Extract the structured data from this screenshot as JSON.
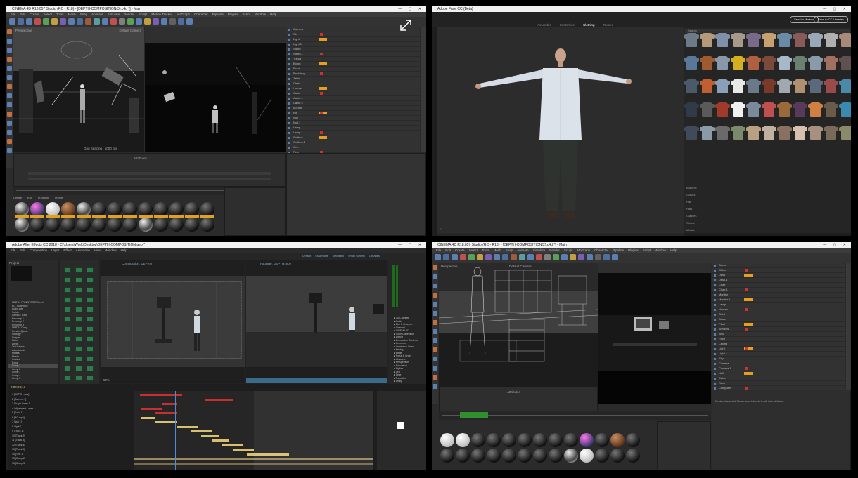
{
  "screens": [
    {
      "title": "CINEMA 4D R18.057 Studio (RC - R18) - [DEPTH-COMPOSITION(3).c4d *] - Main",
      "menu": [
        "File",
        "Edit",
        "Create",
        "Select",
        "Tools",
        "Mesh",
        "Snap",
        "Animate",
        "Simulate",
        "Render",
        "Sculpt",
        "Motion Tracker",
        "MoGraph",
        "Character",
        "Pipeline",
        "Plugins",
        "Script",
        "Window",
        "Help"
      ],
      "layout_label": "Startup (User)",
      "viewport_label": "Perspective",
      "viewport_camera": "Default Camera",
      "grid_spacing": "Grid Spacing : 1000 cm",
      "frame_label": "Frame: 93",
      "objects": [
        "Camera",
        "Sky",
        "Light",
        "Light.1",
        "Stand",
        "Stand.1",
        "Tripod",
        "Boom",
        "Floor",
        "Backdrop",
        "Table",
        "Chair",
        "Human",
        "Cable",
        "Cable.1",
        "Cable.2",
        "Monitor",
        "Rig",
        "Null",
        "Null.1",
        "Lamp",
        "Lamp.1",
        "Softbox",
        "Softbox.1",
        "Grip",
        "Flag",
        "C-Stand",
        "Sandbag",
        "Dolly",
        "Track",
        "Crane",
        "Camera.1",
        "Camera.2",
        "Target"
      ],
      "attributes_label": "Attributes",
      "materials_tabs": [
        "Create",
        "Edit",
        "Function",
        "Texture"
      ]
    },
    {
      "title": "Adobe Fuse CC (Beta)",
      "tabs": [
        "Assemble",
        "Customize",
        "Clothing",
        "Texture"
      ],
      "active_tab": "Clothing",
      "buttons": [
        "Send to Mixamo",
        "Save to CC Libraries"
      ],
      "search_label": "Search",
      "category": "Tops",
      "side_categories": [
        "Bottoms",
        "Gloves",
        "Hair",
        "Hats",
        "Glasses",
        "Shoes",
        "Masks",
        "Beards"
      ]
    },
    {
      "title": "Adobe After Effects CC 2018 - C:\\Users\\Work\\Desktop\\DEPTH-COMPOSITION.aep *",
      "menu": [
        "File",
        "Edit",
        "Composition",
        "Layer",
        "Effect",
        "Animation",
        "View",
        "Window",
        "Help"
      ],
      "workspace": [
        "Default",
        "Essentials",
        "Standard",
        "Small Screen",
        "Libraries"
      ],
      "project_label": "Project",
      "composition_label": "Composition: DEPTH",
      "footage_label": "Footage: DEPTH.mov",
      "zoom": "50%",
      "timecode": "0;00;03;13",
      "layers": [
        "[DEPTH.mov]",
        "[Camera 1]",
        "Shape Layer 1",
        "Adjustment Layer 1",
        "[Solid 1]",
        "[BG.mp4]",
        "[Null 1]",
        "Light 1",
        "[Track 1]",
        "[Track 2]",
        "[Track 3]",
        "[Track 4]",
        "[Track 5]",
        "[Text 1]",
        "[Comp 2]",
        "[Comp 3]"
      ],
      "effects": [
        "3D Channel",
        "Audio",
        "Blur & Sharpen",
        "Channel",
        "CINEMA 4D",
        "Color Correction",
        "Distort",
        "Expression Controls",
        "Generate",
        "Immersive Video",
        "Keying",
        "Matte",
        "Noise & Grain",
        "Obsolete",
        "Perspective",
        "Simulation",
        "Stylize",
        "Text",
        "Time",
        "Transition",
        "Utility"
      ],
      "project_items": [
        "DEPTH-COMPOSITION.c4d",
        "BG_Plate.mov",
        "Audio.wav",
        "Solids",
        "Camera Track",
        "Precomp 1",
        "Precomp 2",
        "Precomp 3",
        "DEPTH Comp",
        "Render Queue",
        "Footage",
        "Shapes",
        "Nulls",
        "Lights",
        "Text Layers",
        "Adjustments",
        "Mattes",
        "Masks",
        "Guides",
        "Extra",
        "Comp 1",
        "Comp 2",
        "Comp 3",
        "Comp 4",
        "Comp 5"
      ]
    },
    {
      "title": "CINEMA 4D R18.057 Studio (RC - R18) - [DEPTH-COMPOSITION(2).c4d *] - Main",
      "menu": [
        "File",
        "Edit",
        "Create",
        "Select",
        "Tools",
        "Mesh",
        "Snap",
        "Animate",
        "Simulate",
        "Render",
        "Sculpt",
        "MoGraph",
        "Character",
        "Pipeline",
        "Plugins",
        "Script",
        "Window",
        "Help"
      ],
      "viewport_label": "Perspective",
      "viewport_camera": "Default Camera",
      "objects": [
        "Scene",
        "Office",
        "Desk",
        "Desk.1",
        "Chair",
        "Chair.1",
        "Monitor",
        "Monitor.1",
        "Lamp",
        "Human",
        "Shelf",
        "Books",
        "Plant",
        "Window",
        "Wall",
        "Floor",
        "Ceiling",
        "Light",
        "Light.1",
        "Sky",
        "Camera",
        "Camera.1",
        "Null",
        "Cable",
        "Rack",
        "Computer",
        "Keyboard",
        "Mouse",
        "Mug",
        "Paper",
        "Frame",
        "Blinds"
      ],
      "attributes_label": "Attributes",
      "no_object": "No object selected. Please select objects to edit their attributes."
    }
  ],
  "colors": {
    "c4d_blue": "#5a7fb0",
    "accent_orange": "#e0a020",
    "ae_yellow": "#d8c070",
    "ae_red": "#c83030",
    "fuse_bg": "#262626"
  }
}
